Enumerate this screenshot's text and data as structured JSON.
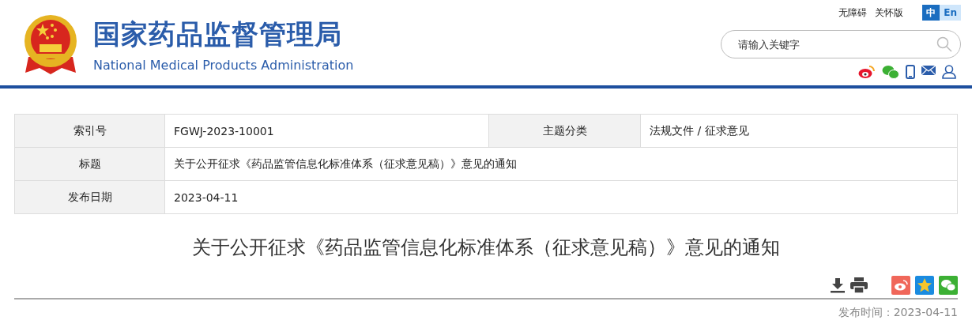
{
  "header": {
    "title": "国家药品监督管理局",
    "subtitle": "National Medical Products Administration",
    "links": [
      "无障碍",
      "关怀版"
    ],
    "languages": [
      {
        "label": "中",
        "selected": true
      },
      {
        "label": "En",
        "selected": false
      }
    ],
    "search": {
      "placeholder": "请输入关键字"
    }
  },
  "info_table": {
    "rows": [
      {
        "cells": [
          {
            "label": "索引号",
            "value": "FGWJ-2023-10001"
          },
          {
            "label": "主题分类",
            "value": "法规文件 / 征求意见"
          }
        ]
      },
      {
        "cells": [
          {
            "label": "标题",
            "value": "关于公开征求《药品监管信息化标准体系（征求意见稿）》意见的通知"
          }
        ]
      },
      {
        "cells": [
          {
            "label": "发布日期",
            "value": "2023-04-11"
          }
        ]
      }
    ]
  },
  "article": {
    "title": "关于公开征求《药品监管信息化标准体系（征求意见稿）》意见的通知",
    "published": "发布时间：2023-04-11"
  }
}
